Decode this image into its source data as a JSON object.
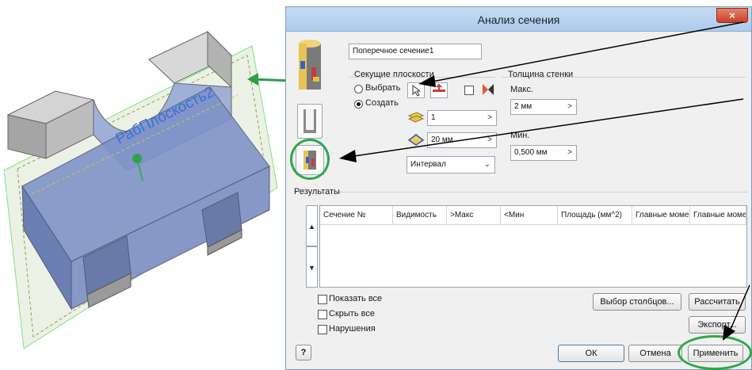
{
  "scene": {
    "work_plane_label": "РабПлоскость2"
  },
  "dialog": {
    "title": "Анализ сечения",
    "close_label": "×",
    "name_value": "Поперечное сечение1",
    "cutting_planes": {
      "title": "Секущие плоскости",
      "select_label": "Выбрать",
      "create_label": "Создать",
      "count_value": "1",
      "spacing_value": "20 мм",
      "mode_value": "Интервал"
    },
    "wall_thickness": {
      "title": "Толщина стенки",
      "max_label": "Макс.",
      "max_value": "2 мм",
      "min_label": "Мин.",
      "min_value": "0,500 мм"
    },
    "results": {
      "title": "Результаты",
      "columns": [
        "Сечение №",
        "Видимость",
        ">Макс",
        "<Мин",
        "Площадь (мм^2)",
        "Главные моме",
        "Главные моме"
      ]
    },
    "options": {
      "show_all": "Показать все",
      "hide_all": "Скрыть все",
      "violations": "Нарушения"
    },
    "buttons": {
      "select_columns": "Выбор столбцов...",
      "calculate": "Рассчитать",
      "export": "Экспорт...",
      "ok": "ОК",
      "cancel": "Отмена",
      "apply": "Применить",
      "help": "?"
    },
    "spin_arrow": ">",
    "dropdown_arrow": "⌄",
    "row_up": "▲",
    "row_down": "▼"
  }
}
